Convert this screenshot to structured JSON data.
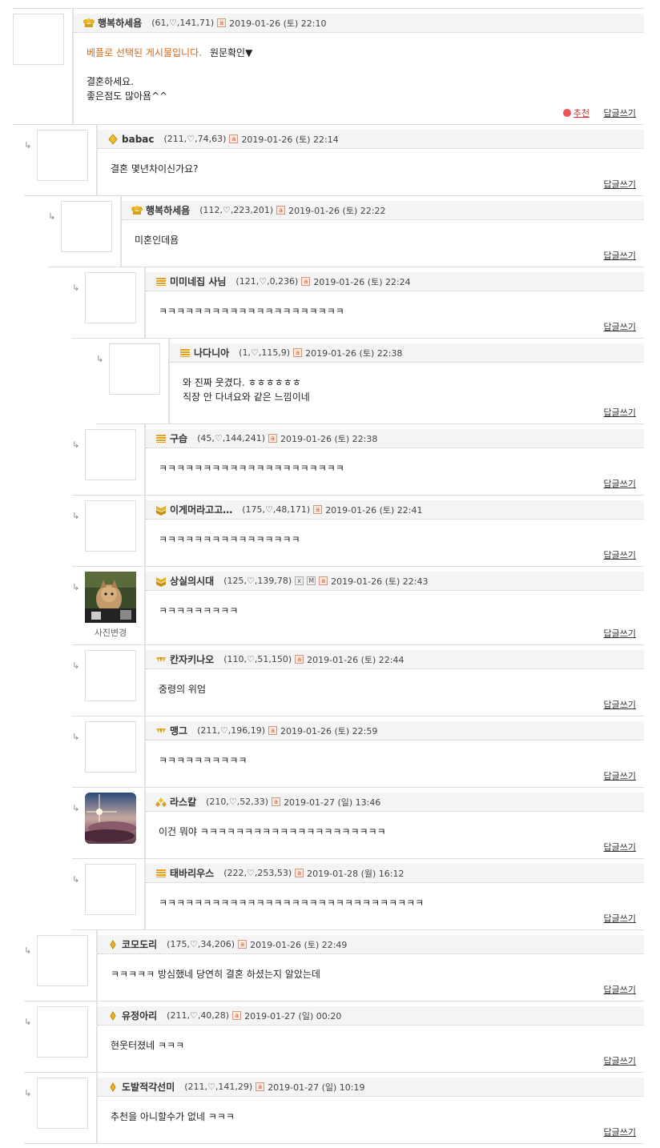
{
  "labels": {
    "reply": "답글쓰기",
    "recommend": "추천",
    "original_link": "원문확인▼",
    "best_notice": "베플로 선택된 게시물입니다.",
    "change_photo": "사진변경",
    "arrow": "↳"
  },
  "colors": {
    "accent": "#d2691e",
    "border": "#dddddd",
    "header_bg": "#f4f4f4"
  },
  "comments": [
    {
      "nick": "행복하세욤",
      "stats": "(61,♡,141,71)",
      "date": "2019-01-26 (토) 22:10",
      "line1": "결혼하세요.",
      "line2": "좋은점도 많아욤^^",
      "icon": "crown-icon"
    },
    {
      "nick": "babac",
      "stats": "(211,♡,74,63)",
      "date": "2019-01-26 (토) 22:14",
      "text": "결혼 몇년차이신가요?",
      "icon": "diamond-icon"
    },
    {
      "nick": "행복하세욤",
      "stats": "(112,♡,223,201)",
      "date": "2019-01-26 (토) 22:22",
      "text": "미혼인데욤",
      "icon": "crown-icon"
    },
    {
      "nick": "미미네집 사님",
      "stats": "(121,♡,0,236)",
      "date": "2019-01-26 (토) 22:24",
      "text": "ㅋㅋㅋㅋㅋㅋㅋㅋㅋㅋㅋㅋㅋㅋㅋㅋㅋㅋㅋㅋㅋ",
      "icon": "bars-icon"
    },
    {
      "nick": "나다니아",
      "stats": "(1,♡,115,9)",
      "date": "2019-01-26 (토) 22:38",
      "line1": "와 진짜 웃겼다. ㅎㅎㅎㅎㅎㅎ",
      "line2": "직장 안 다녀요와 같은 느낌이네",
      "icon": "bars-icon"
    },
    {
      "nick": "구습",
      "stats": "(45,♡,144,241)",
      "date": "2019-01-26 (토) 22:38",
      "text": "ㅋㅋㅋㅋㅋㅋㅋㅋㅋㅋㅋㅋㅋㅋㅋㅋㅋㅋㅋㅋㅋ",
      "icon": "bars-icon"
    },
    {
      "nick": "이게머라고고…",
      "stats": "(175,♡,48,171)",
      "date": "2019-01-26 (토) 22:41",
      "text": "ㅋㅋㅋㅋㅋㅋㅋㅋㅋㅋㅋㅋㅋㅋㅋㅋ",
      "icon": "chevron-badge-icon"
    },
    {
      "nick": "상실의시대",
      "stats": "(125,♡,139,78)",
      "date": "2019-01-26 (토) 22:43",
      "text": "ㅋㅋㅋㅋㅋㅋㅋㅋㅋ",
      "icon": "chevron-badge-icon",
      "badges": [
        "x",
        "M"
      ]
    },
    {
      "nick": "칸자키나오",
      "stats": "(110,♡,51,150)",
      "date": "2019-01-26 (토) 22:44",
      "text": "중령의 위엄",
      "icon": "wings-icon"
    },
    {
      "nick": "맹그",
      "stats": "(211,♡,196,19)",
      "date": "2019-01-26 (토) 22:59",
      "text": "ㅋㅋㅋㅋㅋㅋㅋㅋㅋㅋ",
      "icon": "wings-icon"
    },
    {
      "nick": "라스칼",
      "stats": "(210,♡,52,33)",
      "date": "2019-01-27 (일) 13:46",
      "text": "이건 뭐야 ㅋㅋㅋㅋㅋㅋㅋㅋㅋㅋㅋㅋㅋㅋㅋㅋㅋㅋㅋㅋㅋ",
      "icon": "gem-cluster-icon"
    },
    {
      "nick": "태바리우스",
      "stats": "(222,♡,253,53)",
      "date": "2019-01-28 (월) 16:12",
      "text": "ㅋㅋㅋㅋㅋㅋㅋㅋㅋㅋㅋㅋㅋㅋㅋㅋㅋㅋㅋㅋㅋㅋㅋㅋㅋㅋㅋㅋㅋㅋ",
      "icon": "bars-icon"
    },
    {
      "nick": "코모도리",
      "stats": "(175,♡,34,206)",
      "date": "2019-01-26 (토) 22:49",
      "text": "ㅋㅋㅋㅋㅋ 방심했네 당연히 결혼 하셨는지 알았는데",
      "icon": "small-diamond-icon"
    },
    {
      "nick": "유정아리",
      "stats": "(211,♡,40,28)",
      "date": "2019-01-27 (일) 00:20",
      "text": "현웃터졌네 ㅋㅋㅋ",
      "icon": "small-diamond-icon"
    },
    {
      "nick": "도발적각선미",
      "stats": "(211,♡,141,29)",
      "date": "2019-01-27 (일) 10:19",
      "text": "추천을 아니할수가 없네 ㅋㅋㅋ",
      "icon": "small-diamond-icon"
    }
  ]
}
